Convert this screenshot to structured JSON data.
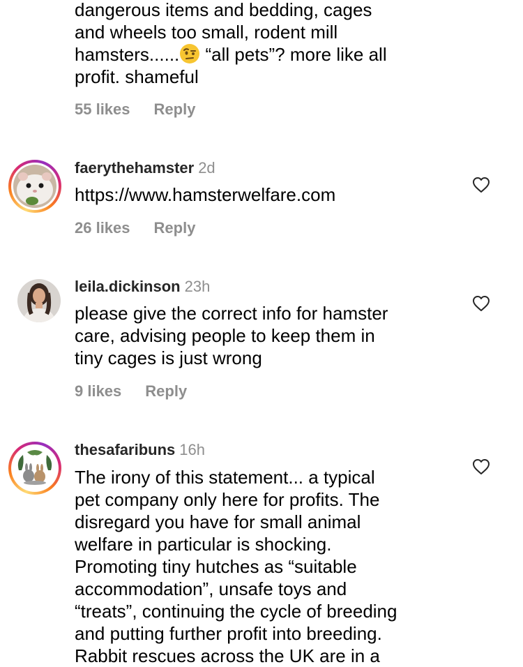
{
  "comments": [
    {
      "text_lines": [
        "dangerous items and bedding, cages",
        "and wheels too small, rodent mill",
        "hamsters......",
        "profit. shameful"
      ],
      "emoji": "face-with-raised-eyebrow",
      "text_after_emoji": "“all pets”? more like all",
      "likes": "55 likes",
      "reply": "Reply"
    },
    {
      "username": "faerythehamster",
      "time": "2d",
      "text": "https://www.hamsterwelfare.com",
      "likes": "26 likes",
      "reply": "Reply",
      "avatar": "hamster-avatar"
    },
    {
      "username": "leila.dickinson",
      "time": "23h",
      "text_lines": [
        "please give the correct info for hamster",
        "care, advising people to keep them in",
        "tiny cages is just wrong"
      ],
      "likes": "9 likes",
      "reply": "Reply",
      "avatar": "user-photo-avatar"
    },
    {
      "username": "thesafaribuns",
      "time": "16h",
      "text_lines": [
        "The irony of this statement... a typical",
        "pet company only here for profits. The",
        "disregard you have for small animal",
        "welfare in particular is shocking.",
        "Promoting tiny hutches as “suitable",
        "accommodation”, unsafe toys and",
        "“treats”, continuing the cycle of breeding",
        "and putting further profit into breeding.",
        "Rabbit rescues across the UK are in a"
      ],
      "avatar": "rabbits-avatar"
    }
  ],
  "colors": {
    "muted": "#8e8e8e",
    "text": "#000000",
    "username": "#262626"
  },
  "icons": {
    "like": "heart-outline-icon"
  }
}
